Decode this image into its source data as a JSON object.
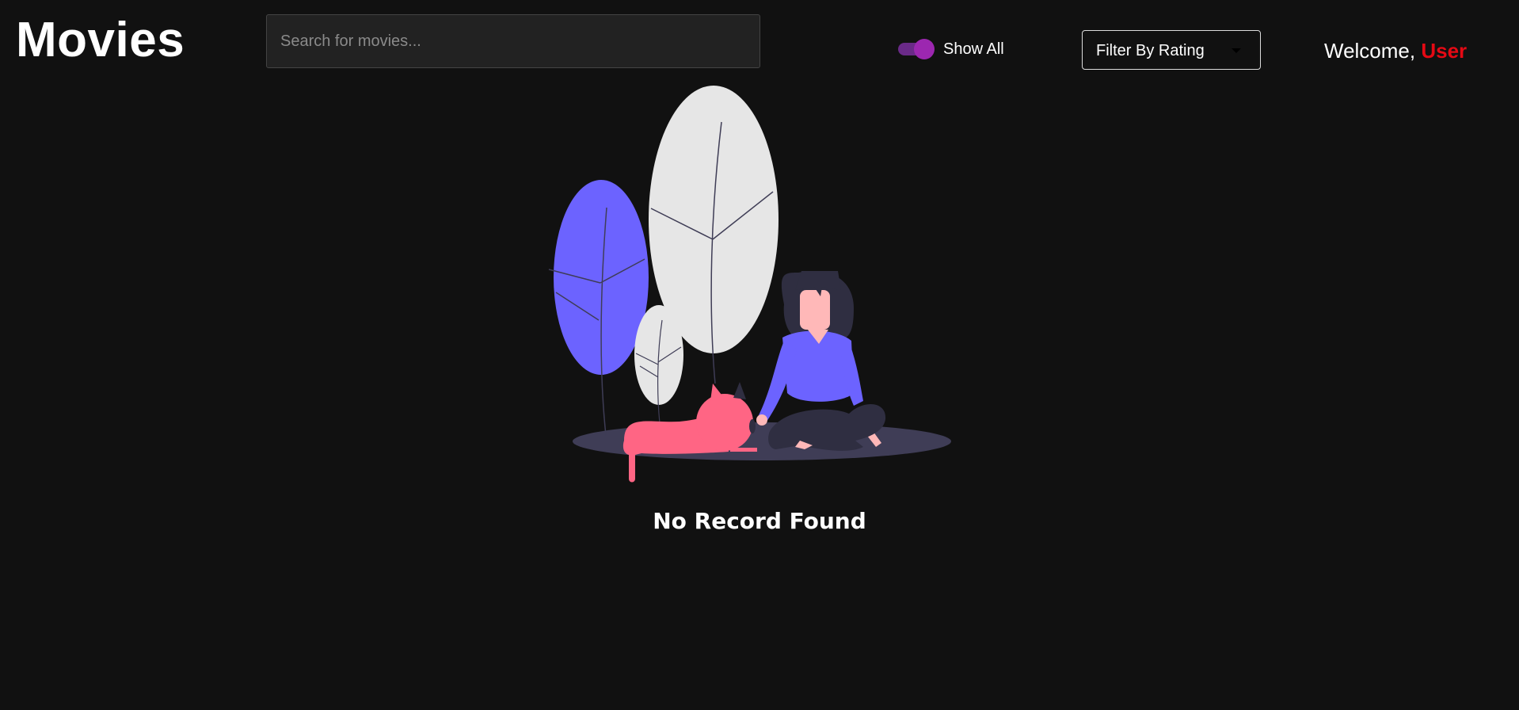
{
  "header": {
    "title": "Movies",
    "search": {
      "placeholder": "Search for movies...",
      "value": ""
    },
    "toggle": {
      "label": "Show All",
      "on": true,
      "color": "#9c27b0"
    },
    "rating_filter": {
      "label": "Filter By Rating",
      "icon": "chevron-down-icon"
    },
    "welcome": {
      "prefix": "Welcome,",
      "user": "User",
      "user_color": "#e50914"
    }
  },
  "main": {
    "empty_state": {
      "message": "No Record Found",
      "illustration": "empty-state-illustration",
      "colors": {
        "accent": "#6c63ff",
        "leaf_light": "#e6e6e6",
        "cat": "#ff6584",
        "floor": "#3f3d56",
        "hair": "#2f2e41"
      }
    }
  }
}
